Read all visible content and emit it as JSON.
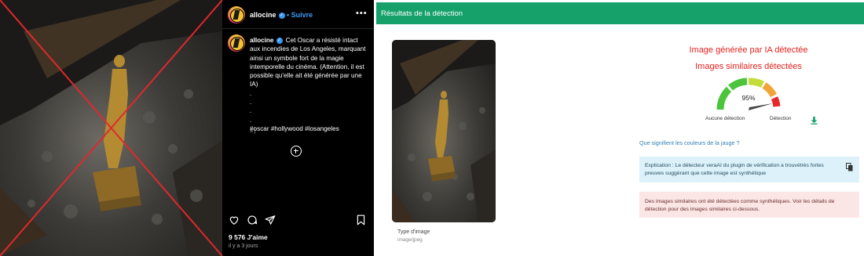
{
  "instagram": {
    "username": "allocine",
    "follow_label": "Suivre",
    "more_label": "•••",
    "verified_symbol": "✓",
    "caption_user": "allocine",
    "caption_text": "Cet Oscar a résisté intact aux incendies de Los Angeles, marquant ainsi un symbole fort de la magie intemporelle du cinéma. (Attention, il est possible qu'elle ait été générée par une IA)",
    "caption_dots": [
      ".",
      ".",
      ".",
      "."
    ],
    "hashtags": "#oscar #hollywood #losangeles",
    "comment_time": "3 j",
    "likes": "9 576 J'aime",
    "post_date": "il y a 3 jours",
    "icons": [
      "heart-icon",
      "comment-icon",
      "share-icon",
      "bookmark-icon",
      "add-comment-icon"
    ],
    "photo_marker_color": "#e0282c"
  },
  "detection": {
    "header_title": "Résultats de la détection",
    "header_color": "#16a16b",
    "image_type_label": "Type d'image",
    "image_type_value": "image/jpeg",
    "ai_detected": "Image générée par IA détectée",
    "similar_detected": "Images similaires détectées",
    "gauge": {
      "percent_label": "95%",
      "value": 0.95,
      "left_label": "Aucune détection",
      "right_label": "Détection",
      "segment_colors": [
        "#4cc43c",
        "#c5dc38",
        "#f2a33a",
        "#e8262a"
      ]
    },
    "jauge_link": "Que signifient les couleurs de la jauge ?",
    "explanation": "Explication : Le détecteur veraAI du plugin de vérification a trouvétrès fortes preuves suggérant que cette image est synthétique",
    "similar_note": "Des images similaires ont été détectées comme synthétiques. Voir les détails de détection pour des images similaires ci-dessous."
  }
}
